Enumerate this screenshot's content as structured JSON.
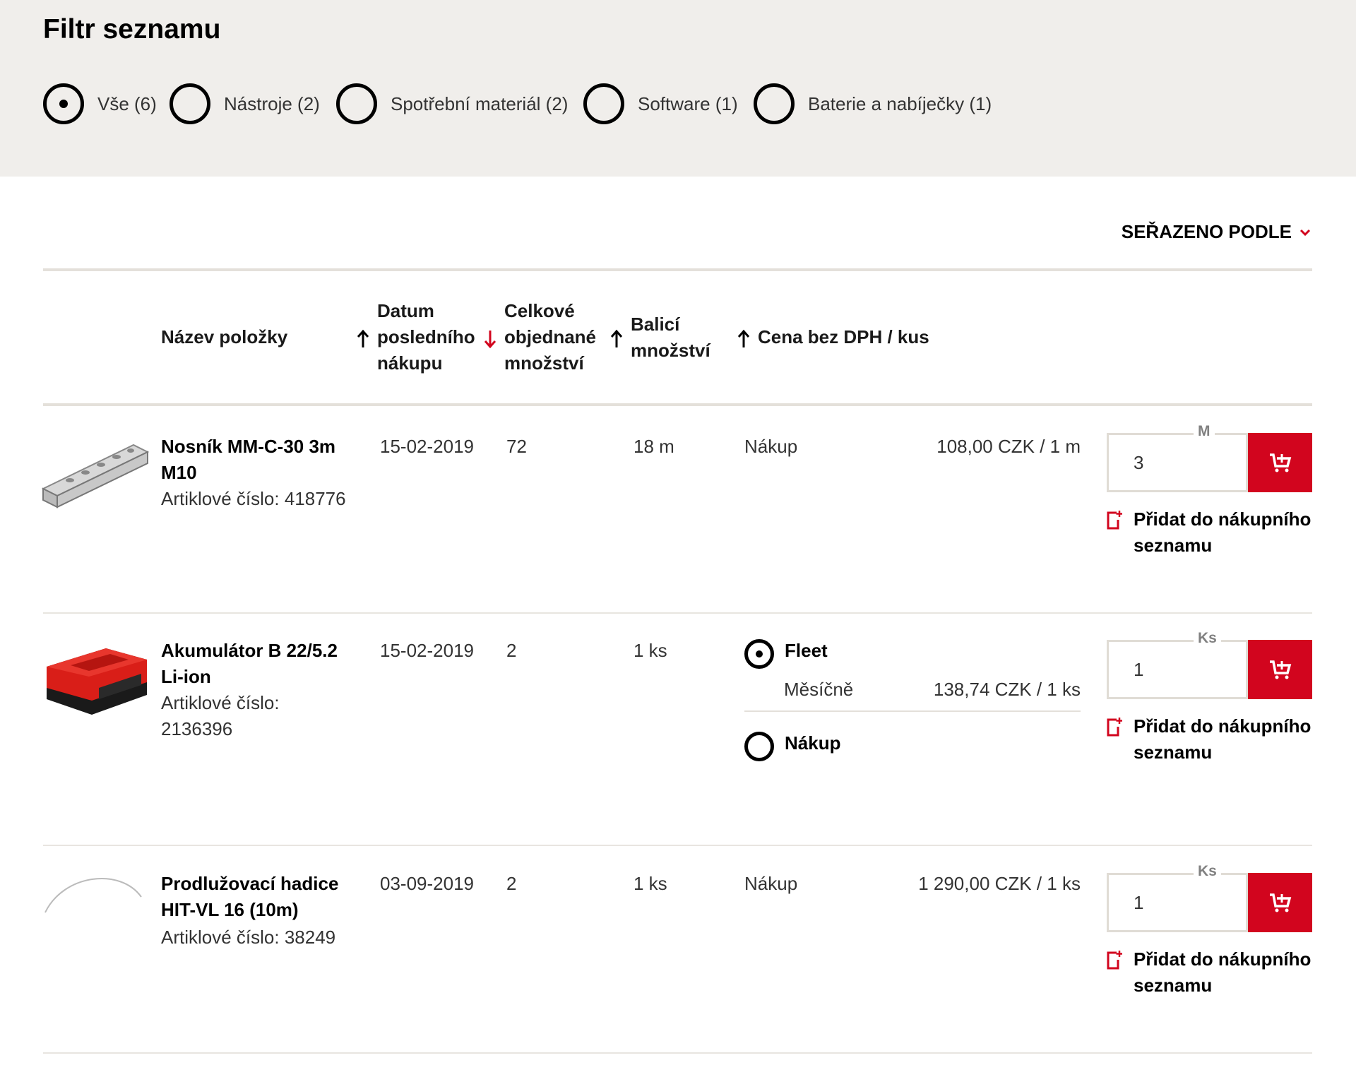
{
  "filter": {
    "title": "Filtr seznamu",
    "options": [
      {
        "label": "Vše (6)",
        "selected": true
      },
      {
        "label": "Nástroje (2)",
        "selected": false
      },
      {
        "label": "Spotřební materiál (2)",
        "selected": false
      },
      {
        "label": "Software (1)",
        "selected": false
      },
      {
        "label": "Baterie a nabíječky (1)",
        "selected": false
      }
    ]
  },
  "sort": {
    "label": "SEŘAZENO PODLE",
    "icon": "chevron-down-icon"
  },
  "table": {
    "headers": {
      "name": "Název položky",
      "last_purchase": "Datum posledního nákupu",
      "total_ordered": "Celkové objednané množství",
      "package_qty": "Balicí množství",
      "price": "Cena bez DPH / kus"
    },
    "sort_arrows": {
      "last_purchase": "up",
      "total_ordered": "down",
      "package_qty": "up",
      "price": "up"
    },
    "rows": [
      {
        "name": "Nosník MM-C-30 3m M10",
        "part_number": "Artiklové číslo: 418776",
        "last_purchase": "15-02-2019",
        "total_ordered": "72",
        "package_qty": "18 m",
        "purchase_label": "Nákup",
        "price": "108,00 CZK / 1 m",
        "qty_value": "3",
        "qty_unit": "M",
        "add_to_list": "Přidat do nákupního seznamu"
      },
      {
        "name": "Akumulátor B 22/5.2 Li-ion",
        "part_number": "Artiklové číslo: 2136396",
        "last_purchase": "15-02-2019",
        "total_ordered": "2",
        "package_qty": "1 ks",
        "fleet_label": "Fleet",
        "fleet_selected": true,
        "monthly_label": "Měsíčně",
        "price": "138,74 CZK / 1 ks",
        "purchase_label": "Nákup",
        "purchase_selected": false,
        "qty_value": "1",
        "qty_unit": "Ks",
        "add_to_list": "Přidat do nákupního seznamu"
      },
      {
        "name": "Prodlužovací hadice HIT-VL 16 (10m)",
        "part_number": "Artiklové číslo: 38249",
        "last_purchase": "03-09-2019",
        "total_ordered": "2",
        "package_qty": "1 ks",
        "purchase_label": "Nákup",
        "price": "1 290,00 CZK / 1 ks",
        "qty_value": "1",
        "qty_unit": "Ks",
        "add_to_list": "Přidat do nákupního seznamu"
      }
    ]
  },
  "colors": {
    "accent": "#d2051e",
    "filter_bg": "#f0eeeb",
    "border": "#e4e0da"
  }
}
